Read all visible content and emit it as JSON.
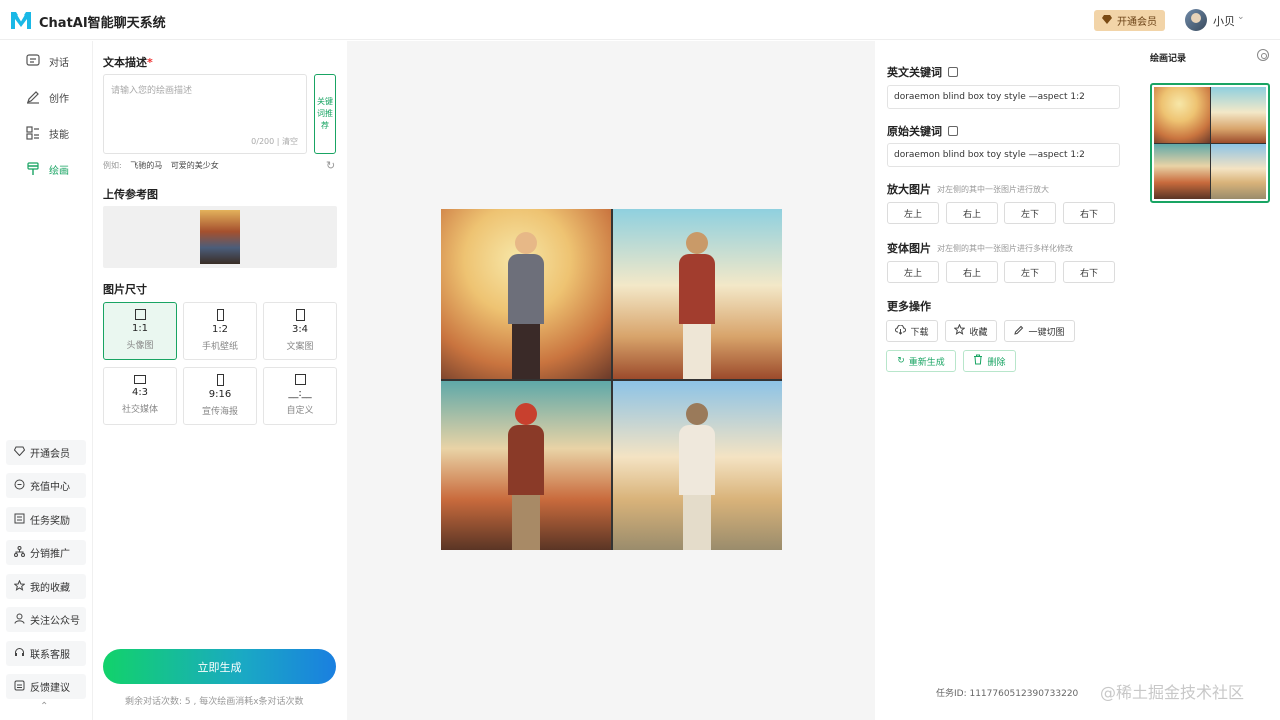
{
  "header": {
    "title": "ChatAI智能聊天系统",
    "vip_label": "开通会员",
    "user_name": "小贝"
  },
  "nav": {
    "items": [
      {
        "label": "对话",
        "icon": "chat-icon"
      },
      {
        "label": "创作",
        "icon": "pencil-icon"
      },
      {
        "label": "技能",
        "icon": "grid-icon"
      },
      {
        "label": "绘画",
        "icon": "brush-icon"
      }
    ],
    "active": "绘画",
    "bottom_items": [
      {
        "label": "开通会员",
        "icon": "diamond-icon"
      },
      {
        "label": "充值中心",
        "icon": "coin-icon"
      },
      {
        "label": "任务奖励",
        "icon": "task-icon"
      },
      {
        "label": "分销推广",
        "icon": "share-icon"
      },
      {
        "label": "我的收藏",
        "icon": "star-icon"
      },
      {
        "label": "关注公众号",
        "icon": "user-icon"
      },
      {
        "label": "联系客服",
        "icon": "headset-icon"
      },
      {
        "label": "反馈建议",
        "icon": "feedback-icon"
      }
    ]
  },
  "form": {
    "text_desc_title": "文本描述",
    "required_mark": "*",
    "placeholder": "请输入您的绘画描述",
    "counter": "0/200",
    "clear_label": "清空",
    "keyword_btn": "关键词推荐",
    "example_prefix": "例如:",
    "examples": [
      "飞驰的马",
      "可爱的美少女"
    ],
    "upload_title": "上传参考图",
    "size_title": "图片尺寸",
    "sizes": [
      {
        "ratio": "1:1",
        "label": "头像图"
      },
      {
        "ratio": "1:2",
        "label": "手机壁纸"
      },
      {
        "ratio": "3:4",
        "label": "文案图"
      },
      {
        "ratio": "4:3",
        "label": "社交媒体"
      },
      {
        "ratio": "9:16",
        "label": "宣传海报"
      },
      {
        "ratio": "__:__",
        "label": "自定义"
      }
    ],
    "selected_size": "1:1",
    "generate_label": "立即生成",
    "remain_text": "剩余对话次数: 5 , 每次绘画消耗x条对话次数"
  },
  "result": {
    "en_kw_title": "英文关键词",
    "en_kw_value": "doraemon blind box toy style —aspect 1:2",
    "orig_kw_title": "原始关键词",
    "orig_kw_value": "doraemon blind box toy style —aspect 1:2",
    "upscale_title": "放大图片",
    "upscale_hint": "对左侧的其中一张图片进行放大",
    "variation_title": "变体图片",
    "variation_hint": "对左侧的其中一张图片进行多样化修改",
    "positions": [
      "左上",
      "右上",
      "左下",
      "右下"
    ],
    "more_title": "更多操作",
    "ops": {
      "download": "下载",
      "favorite": "收藏",
      "cut": "一键切图",
      "regenerate": "重新生成",
      "delete": "删除"
    },
    "task_id": "任务ID: 1117760512390733220"
  },
  "history": {
    "title": "绘画记录"
  },
  "watermark": "@稀土掘金技术社区",
  "colors": {
    "accent": "#19a463",
    "vip_bg": "#f2d4a8",
    "canvas_bg": "#f5f5f5"
  }
}
